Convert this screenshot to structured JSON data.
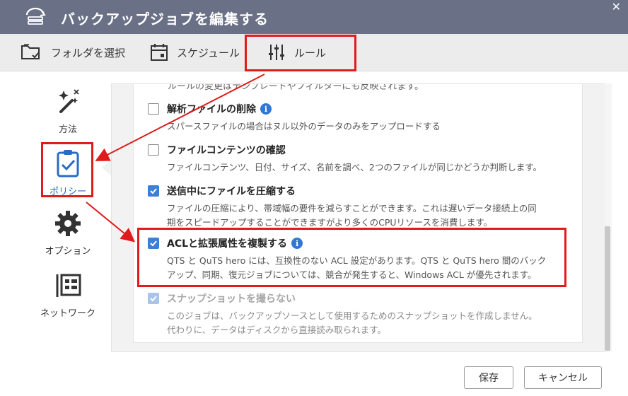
{
  "window": {
    "title": "バックアップジョブを編集する",
    "close_symbol": "✕",
    "icon": "backup-job-icon"
  },
  "tabs": [
    {
      "label": "フォルダを選択",
      "icon": "folder-select-icon"
    },
    {
      "label": "スケジュール",
      "icon": "calendar-icon"
    },
    {
      "label": "ルール",
      "icon": "sliders-icon"
    }
  ],
  "sidebar": {
    "items": [
      {
        "label": "方法",
        "icon": "magic-wand-icon"
      },
      {
        "label": "ポリシー",
        "icon": "clipboard-check-icon",
        "active": true
      },
      {
        "label": "オプション",
        "icon": "gear-icon"
      },
      {
        "label": "ネットワーク",
        "icon": "network-panel-icon"
      }
    ]
  },
  "options": {
    "cut_off_text": "ルールの変更はテンプレートやフィルターにも反映されます。",
    "items": [
      {
        "label": "解析ファイルの削除",
        "checked": false,
        "info": true,
        "desc": [
          "スパースファイルの場合はヌル以外のデータのみをアップロードする"
        ]
      },
      {
        "label": "ファイルコンテンツの確認",
        "checked": false,
        "info": false,
        "desc": [
          "ファイルコンテンツ、日付、サイズ、名前を調べ、2つのファイルが同じかどうか判断します。"
        ]
      },
      {
        "label": "送信中にファイルを圧縮する",
        "checked": true,
        "info": false,
        "desc": [
          "ファイルの圧縮により、帯域幅の要件を減らすことができます。これは遅いデータ接続上の同",
          "期をスピードアップすることができますがより多くのCPUリソースを消費します。"
        ]
      },
      {
        "label": "ACLと拡張属性を複製する",
        "checked": true,
        "info": true,
        "desc": [
          "QTS と QuTS hero には、互換性のない ACL 設定があります。QTS と QuTS hero 間のバック",
          "アップ、同期、復元ジョブについては、競合が発生すると、Windows ACL が優先されます。"
        ]
      },
      {
        "label": "スナップショットを撮らない",
        "checked": true,
        "disabled": true,
        "info": false,
        "desc": [
          "このジョブは、バックアップソースとして使用するためのスナップショットを作成しません。",
          "代わりに、データはディスクから直接読み取られます。"
        ]
      }
    ],
    "info_symbol": "i"
  },
  "buttons": {
    "save": "保存",
    "cancel": "キャンセル"
  },
  "colors": {
    "titlebar": "#6a7085",
    "accent": "#3d7fd5",
    "highlight": "#e01b1b"
  }
}
